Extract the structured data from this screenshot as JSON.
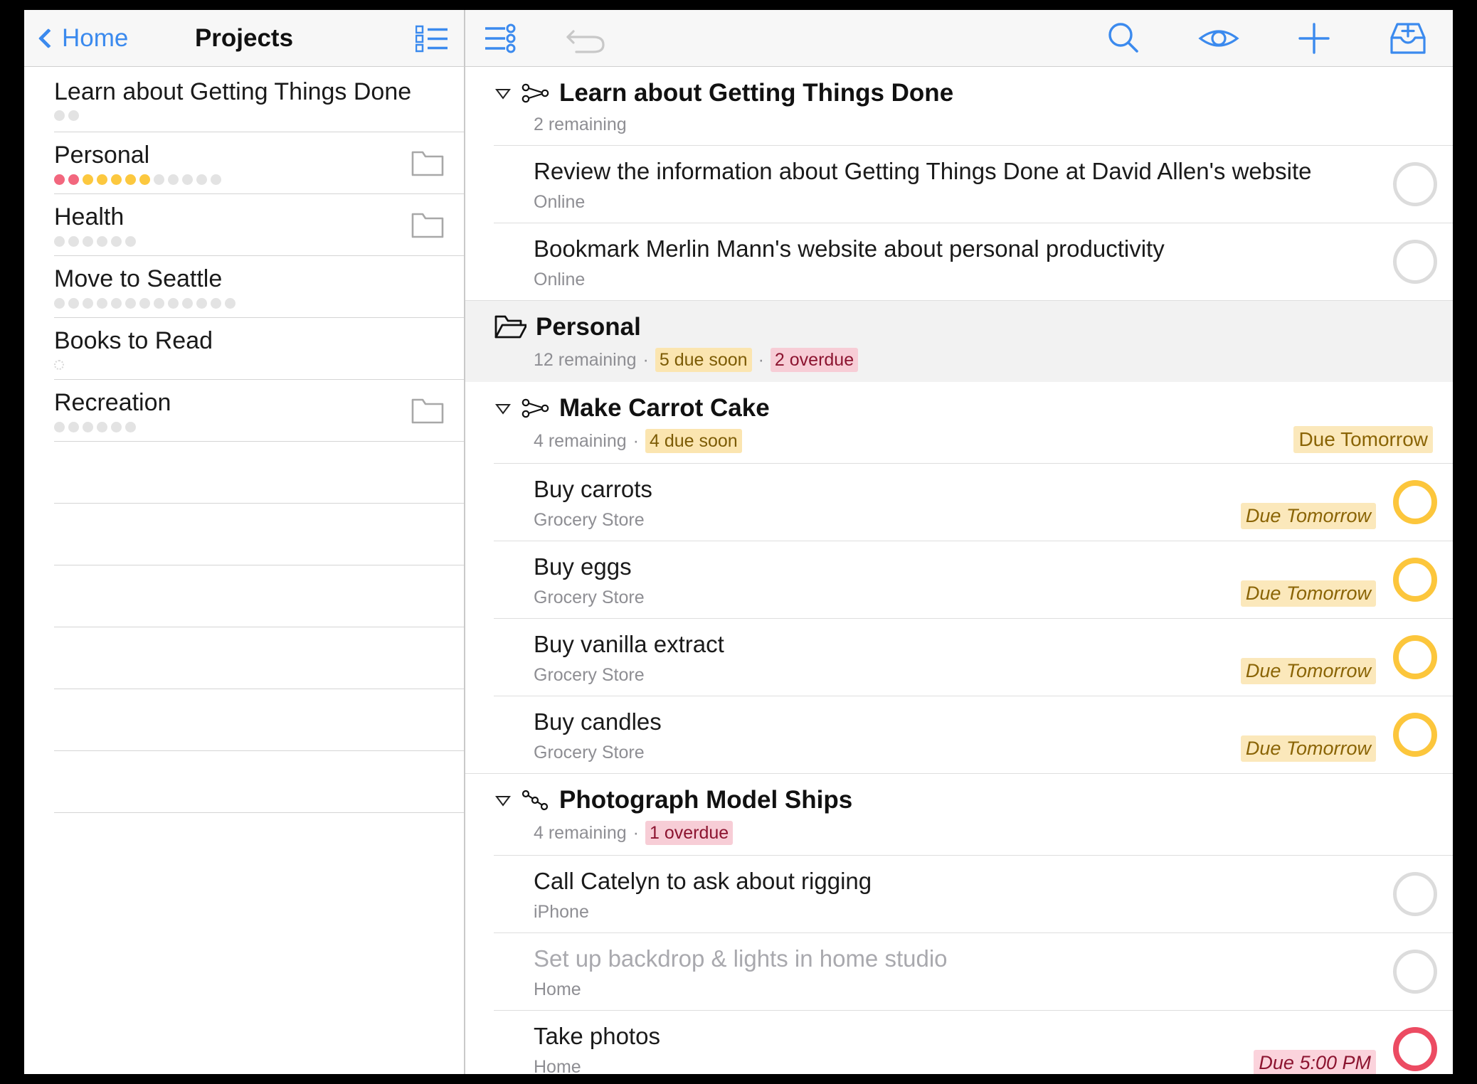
{
  "sidebar": {
    "navbar": {
      "back_label": "Home",
      "title": "Projects",
      "right_icon": "project-list-icon"
    },
    "items": [
      {
        "label": "Learn about Getting Things Done",
        "folder": false,
        "dots": [
          "gray",
          "gray"
        ],
        "empty_dot": false
      },
      {
        "label": "Personal",
        "folder": true,
        "dots": [
          "red",
          "red",
          "yellow",
          "yellow",
          "yellow",
          "yellow",
          "yellow",
          "gray",
          "gray",
          "gray",
          "gray",
          "gray"
        ],
        "empty_dot": false
      },
      {
        "label": "Health",
        "folder": true,
        "dots": [
          "gray",
          "gray",
          "gray",
          "gray",
          "gray",
          "gray"
        ],
        "empty_dot": false
      },
      {
        "label": "Move to Seattle",
        "folder": false,
        "dots": [
          "gray",
          "gray",
          "gray",
          "gray",
          "gray",
          "gray",
          "gray",
          "gray",
          "gray",
          "gray",
          "gray",
          "gray",
          "gray"
        ],
        "empty_dot": false
      },
      {
        "label": "Books to Read",
        "folder": false,
        "dots": [],
        "empty_dot": true
      },
      {
        "label": "Recreation",
        "folder": true,
        "dots": [
          "gray",
          "gray",
          "gray",
          "gray",
          "gray",
          "gray"
        ],
        "empty_dot": false
      }
    ],
    "empty_row_count": 6
  },
  "main": {
    "toolbar": {
      "left": [
        {
          "name": "view-options-icon",
          "label": "View Options",
          "enabled": true
        },
        {
          "name": "undo-icon",
          "label": "Undo",
          "enabled": false
        }
      ],
      "right": [
        {
          "name": "search-icon",
          "label": "Search"
        },
        {
          "name": "eye-icon",
          "label": "View"
        },
        {
          "name": "plus-icon",
          "label": "New Item"
        },
        {
          "name": "inbox-add-icon",
          "label": "Quick Entry"
        }
      ]
    },
    "groups": [
      {
        "kind": "project",
        "project_type": "parallel",
        "title": "Learn about Getting Things Done",
        "remaining": "2 remaining",
        "badges": [],
        "due_label": null,
        "selected": false,
        "tasks": [
          {
            "title": "Review the information about Getting Things Done at David Allen's website",
            "context": "Online",
            "due": null,
            "due_state": "none",
            "circle": "none",
            "blocked": false
          },
          {
            "title": "Bookmark Merlin Mann's website about personal productivity",
            "context": "Online",
            "due": null,
            "due_state": "none",
            "circle": "none",
            "blocked": false
          }
        ]
      },
      {
        "kind": "folder",
        "project_type": "folder",
        "title": "Personal",
        "remaining": "12 remaining",
        "badges": [
          {
            "text": "5 due soon",
            "type": "soon"
          },
          {
            "text": "2 overdue",
            "type": "overdue"
          }
        ],
        "due_label": null,
        "selected": true,
        "tasks": []
      },
      {
        "kind": "project",
        "project_type": "parallel",
        "title": "Make Carrot Cake",
        "remaining": "4 remaining",
        "badges": [
          {
            "text": "4 due soon",
            "type": "soon"
          }
        ],
        "due_label": "Due Tomorrow",
        "selected": false,
        "tasks": [
          {
            "title": "Buy carrots",
            "context": "Grocery Store",
            "due": "Due Tomorrow",
            "due_state": "soon",
            "circle": "soon",
            "blocked": false
          },
          {
            "title": "Buy eggs",
            "context": "Grocery Store",
            "due": "Due Tomorrow",
            "due_state": "soon",
            "circle": "soon",
            "blocked": false
          },
          {
            "title": "Buy vanilla extract",
            "context": "Grocery Store",
            "due": "Due Tomorrow",
            "due_state": "soon",
            "circle": "soon",
            "blocked": false
          },
          {
            "title": "Buy candles",
            "context": "Grocery Store",
            "due": "Due Tomorrow",
            "due_state": "soon",
            "circle": "soon",
            "blocked": false
          }
        ]
      },
      {
        "kind": "project",
        "project_type": "sequential",
        "title": "Photograph Model Ships",
        "remaining": "4 remaining",
        "badges": [
          {
            "text": "1 overdue",
            "type": "overdue"
          }
        ],
        "due_label": null,
        "selected": false,
        "tasks": [
          {
            "title": "Call Catelyn to ask about rigging",
            "context": "iPhone",
            "due": null,
            "due_state": "none",
            "circle": "none",
            "blocked": false
          },
          {
            "title": "Set up backdrop & lights in home studio",
            "context": "Home",
            "due": null,
            "due_state": "none",
            "circle": "none",
            "blocked": true
          },
          {
            "title": "Take photos",
            "context": "Home",
            "due": "Due 5:00 PM",
            "due_state": "over",
            "circle": "over",
            "blocked": false
          }
        ]
      }
    ]
  },
  "colors": {
    "accent_blue": "#3b8aee",
    "due_soon_yellow": "#fcc63c",
    "overdue_red": "#ec4b62",
    "badge_soon_bg": "#fbe8bb",
    "badge_overdue_bg": "#f7cdd6",
    "separator": "#dedede",
    "secondary_text": "#8e8e93"
  }
}
